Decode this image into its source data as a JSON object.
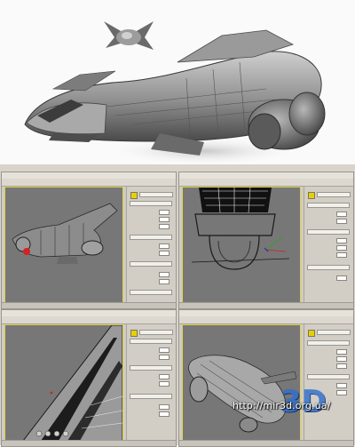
{
  "hero": {
    "subject": "spaceship-render"
  },
  "viewports": [
    {
      "id": "perspective",
      "content": "ship-side-view"
    },
    {
      "id": "front",
      "content": "engine-wireframe"
    },
    {
      "id": "left",
      "content": "hull-closeup"
    },
    {
      "id": "camera",
      "content": "ship-shaded-view"
    }
  ],
  "watermark": {
    "url": "http://mir3d.org.ua/",
    "logo": "3D"
  },
  "colors": {
    "viewport_bg": "#777777",
    "viewport_border": "#e0d24a",
    "logo_blue": "#2f6fcf"
  }
}
